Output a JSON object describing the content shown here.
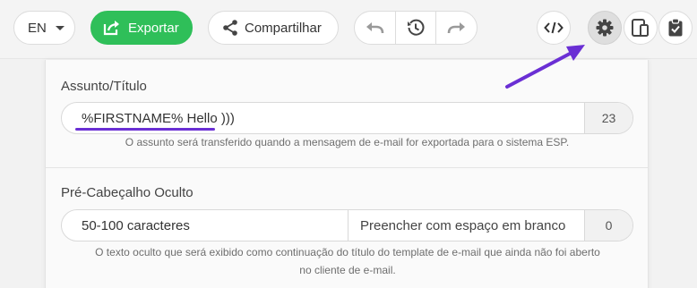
{
  "toolbar": {
    "language": "EN",
    "export_label": "Exportar",
    "share_label": "Compartilhar",
    "icons": {
      "export": "export-icon",
      "share": "share-icon",
      "undo": "undo-icon",
      "history": "history-icon",
      "redo": "redo-icon",
      "code": "code-icon",
      "settings": "gear-icon",
      "mobile": "mobile-preview-icon",
      "clipboard": "clipboard-check-icon"
    }
  },
  "subject": {
    "label": "Assunto/Título",
    "value": "%FIRSTNAME% Hello )))",
    "count": "23",
    "hint": "O assunto será transferido quando a mensagem de e-mail for exportada para o sistema ESP."
  },
  "preheader": {
    "label": "Pré-Cabeçalho Oculto",
    "placeholder": "50-100 caracteres",
    "fill_label": "Preencher com espaço em branco",
    "count": "0",
    "hint_line1": "O texto oculto que será exibido como continuação do título do template de e-mail que ainda não foi aberto",
    "hint_line2": "no cliente de e-mail."
  },
  "colors": {
    "accent_green": "#2fbf59",
    "annotation_purple": "#6a2fd4"
  }
}
